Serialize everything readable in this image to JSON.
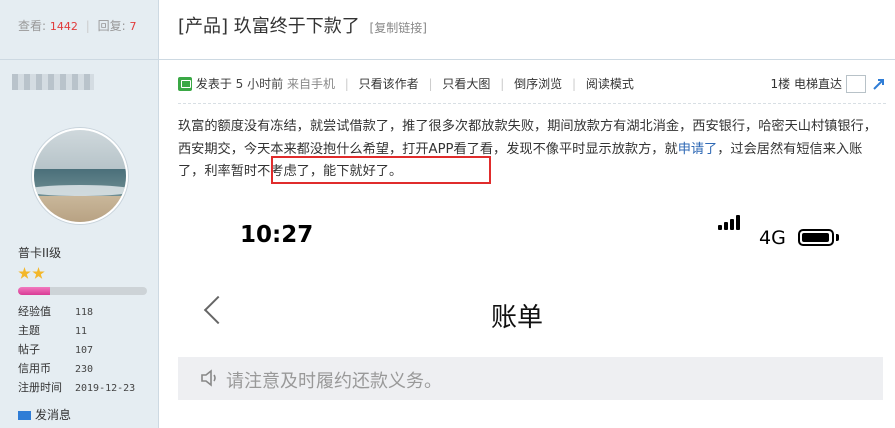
{
  "stats": {
    "views_label": "查看:",
    "views": "1442",
    "sep": "|",
    "replies_label": "回复:",
    "replies": "7"
  },
  "thread": {
    "title": "[产品] 玖富终于下款了",
    "copy_link": "[复制链接]"
  },
  "user": {
    "rank": "普卡II级",
    "stars": 2,
    "progress": 0.25,
    "info": [
      {
        "label": "经验值",
        "value": "118"
      },
      {
        "label": "主题",
        "value": "11"
      },
      {
        "label": "帖子",
        "value": "107"
      },
      {
        "label": "信用币",
        "value": "230"
      },
      {
        "label": "注册时间",
        "value": "2019-12-23"
      }
    ],
    "message_label": "发消息"
  },
  "toolbar": {
    "posted_prefix": "发表于",
    "time": "5 小时前",
    "source": "来自手机",
    "only_author": "只看该作者",
    "large_image": "只看大图",
    "reverse": "倒序浏览",
    "read_mode": "阅读模式",
    "floor": "1楼",
    "elevator": "电梯直达"
  },
  "post": {
    "text_before": "玖富的额度没有冻结，就尝试借款了，推了很多次都放款失败，期间放款方有湖北消金，西安银行，哈密天山村镇银行，西安期交，今天本来都没抱什么希望，打开APP看了看，发现不像平时显示放款方，就",
    "apply_link": "申请了",
    "text_after": "，过会居然有短信来入账了，",
    "highlighted": "利率暂时不考虑了，能下就好了。"
  },
  "phone": {
    "time": "10:27",
    "network": "4G",
    "signal_bars": 4,
    "battery_level": 0.9,
    "title": "账单",
    "notice": "请注意及时履约还款义务。"
  },
  "colors": {
    "accent_red": "#e02c2c",
    "link_blue": "#2f69b5",
    "sidebar_bg": "#e5edf2",
    "progress_pink": "#d83b95"
  }
}
